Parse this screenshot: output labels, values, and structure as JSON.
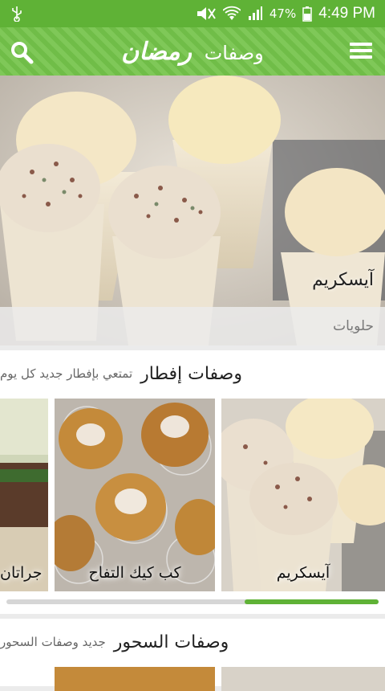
{
  "status_bar": {
    "battery": "47%",
    "time": "4:49 PM"
  },
  "app_bar": {
    "title_prefix": "وصفات",
    "title_brand": "رمضان"
  },
  "hero": {
    "title": "آيسكريم",
    "category": "حلويات"
  },
  "sections": [
    {
      "name": "وصفات إفطار",
      "subtitle": "تمتعي بإفطار جديد كل يوم",
      "cards": [
        "آيسكريم",
        "كب كيك التفاح",
        "جراتان"
      ],
      "scroll_position": 0.36
    },
    {
      "name": "وصفات السحور",
      "subtitle": "جديد وصفات السحور",
      "cards": [
        "",
        ""
      ]
    }
  ],
  "colors": {
    "status_bar": "#5fb236",
    "app_bar": "#74c34a",
    "accent": "#5fb236"
  },
  "icons": [
    "usb-icon",
    "mute-icon",
    "wifi-icon",
    "signal-icon",
    "battery-icon",
    "search-icon",
    "menu-icon"
  ]
}
